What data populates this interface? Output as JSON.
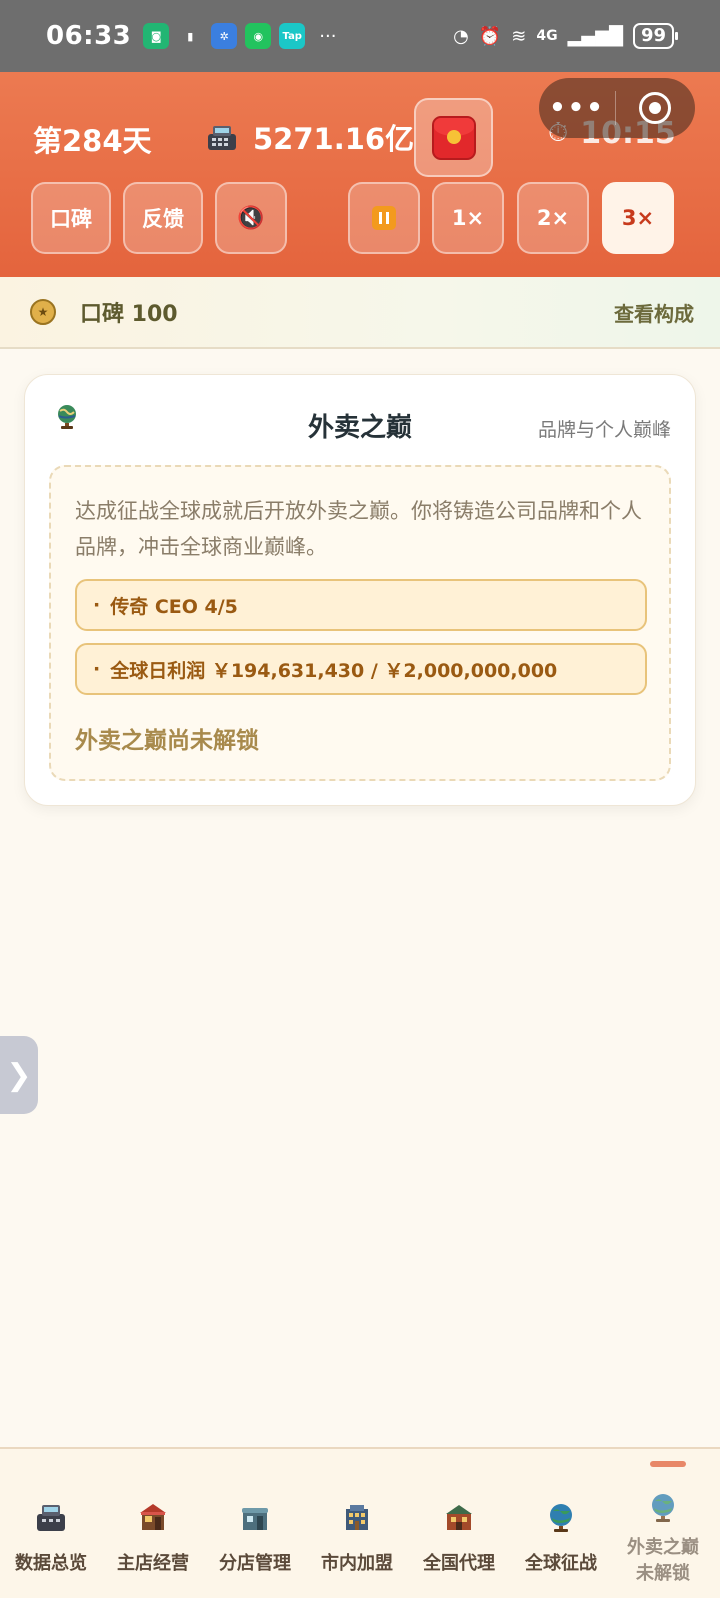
{
  "status_bar": {
    "time": "06:33",
    "app_icons": [
      "mi-icon",
      "battery-saver-icon",
      "tplink-icon",
      "wechat-icon",
      "tap-icon"
    ],
    "more": "···",
    "network": "4G",
    "battery": "99"
  },
  "header": {
    "day": "第284天",
    "money": "5271.16亿",
    "time": "10:15",
    "buttons": {
      "reputation": "口碑",
      "feedback": "反馈",
      "speed1": "1×",
      "speed2": "2×",
      "speed3": "3×"
    },
    "capsule_more": "•••"
  },
  "reputation_bar": {
    "label": "口碑 100",
    "link": "查看构成"
  },
  "card": {
    "title": "外卖之巅",
    "subtitle": "品牌与个人巅峰",
    "description": "达成征战全球成就后开放外卖之巅。你将铸造公司品牌和个人品牌，冲击全球商业巅峰。",
    "requirements": [
      "传奇 CEO 4/5",
      "全球日利润 ￥194,631,430 / ￥2,000,000,000"
    ],
    "locked_text": "外卖之巅尚未解锁"
  },
  "side_handle": "❯",
  "bottom_nav": {
    "tabs": [
      {
        "label": "数据总览",
        "icon": "cash-register-icon"
      },
      {
        "label": "主店经营",
        "icon": "shop-icon"
      },
      {
        "label": "分店管理",
        "icon": "branch-store-icon"
      },
      {
        "label": "市内加盟",
        "icon": "city-franchise-icon"
      },
      {
        "label": "全国代理",
        "icon": "national-agency-icon"
      },
      {
        "label": "全球征战",
        "icon": "globe-icon"
      },
      {
        "label": "外卖之巅",
        "label2": "未解锁",
        "icon": "globe-icon"
      }
    ]
  },
  "colors": {
    "header_orange": "#e8663f",
    "active_button": "#fff3e8",
    "requirement_bg": "#fff1d6",
    "requirement_text": "#9a5a12"
  }
}
